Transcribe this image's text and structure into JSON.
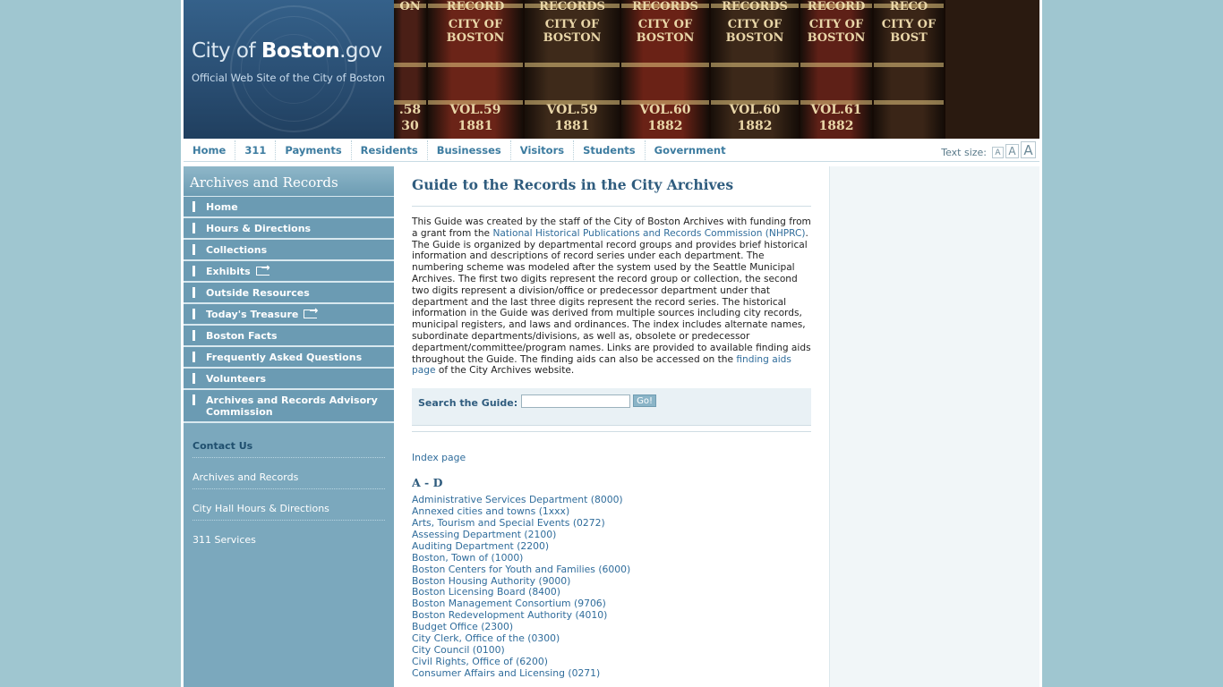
{
  "header": {
    "logo_city": "City of",
    "logo_boston": "Boston",
    "logo_domain": ".gov",
    "logo_tagline": "Official Web Site of the City of Boston",
    "books": [
      {
        "top": "ON",
        "mid": "",
        "vol": ".58",
        "year": "30"
      },
      {
        "top": "RECORD",
        "mid": "CITY OF\nBOSTON",
        "vol": "VOL.59",
        "year": "1881"
      },
      {
        "top": "RECORDS",
        "mid": "CITY OF\nBOSTON",
        "vol": "VOL.59",
        "year": "1881"
      },
      {
        "top": "RECORDS",
        "mid": "CITY OF\nBOSTON",
        "vol": "VOL.60",
        "year": "1882"
      },
      {
        "top": "RECORDS",
        "mid": "CITY OF\nBOSTON",
        "vol": "VOL.60",
        "year": "1882"
      },
      {
        "top": "RECORD",
        "mid": "CITY OF\nBOSTON",
        "vol": "VOL.61",
        "year": "1882"
      },
      {
        "top": "RECO",
        "mid": "CITY OF\nBOST",
        "vol": "",
        "year": ""
      }
    ]
  },
  "topnav": {
    "items": [
      "Home",
      "311",
      "Payments",
      "Residents",
      "Businesses",
      "Visitors",
      "Students",
      "Government"
    ],
    "text_size_label": "Text size:",
    "text_size_glyph": "A"
  },
  "sidebar": {
    "title": "Archives and Records",
    "menu": [
      {
        "label": "Home",
        "external": false
      },
      {
        "label": "Hours & Directions",
        "external": false
      },
      {
        "label": "Collections",
        "external": false
      },
      {
        "label": "Exhibits",
        "external": true
      },
      {
        "label": "Outside Resources",
        "external": false
      },
      {
        "label": "Today's Treasure",
        "external": true
      },
      {
        "label": "Boston Facts",
        "external": false
      },
      {
        "label": "Frequently Asked Questions",
        "external": false
      },
      {
        "label": "Volunteers",
        "external": false
      },
      {
        "label": "Archives and Records Advisory Commission",
        "external": false
      }
    ],
    "links": [
      "Contact Us",
      "Archives and Records",
      "City Hall Hours & Directions",
      "311 Services"
    ]
  },
  "main": {
    "title": "Guide to the Records in the City Archives",
    "intro_1": "This Guide was created by the staff of the City of Boston Archives with funding from a grant from the ",
    "intro_link_1": "National Historical Publications and Records Commission (NHPRC)",
    "intro_2": ". The Guide is organized by departmental record groups and provides brief historical information and descriptions of record series under each department. The numbering scheme was modeled after the system used by the Seattle Municipal Archives. The first two digits represent the record group or collection, the second two digits represent a division/office or predecessor department under that department and the last three digits represent the record series. The historical information in the Guide was derived from multiple sources including city records, municipal registers, and laws and ordinances. The index includes alternate names, subordinate departments/divisions, as well as, obsolete or predecessor department/committee/program names. Links are provided to available finding aids throughout the Guide. The finding aids can also be accessed on the ",
    "intro_link_2": "finding aids page",
    "intro_3": " of the City Archives website.",
    "search_label": "Search the Guide:",
    "search_value": "",
    "search_button": "Go!",
    "index_link": "Index page",
    "section": "A - D",
    "departments": [
      "Administrative Services Department (8000)",
      "Annexed cities and towns (1xxx)",
      "Arts, Tourism and Special Events (0272)",
      "Assessing Department (2100)",
      "Auditing Department (2200)",
      "Boston, Town of (1000)",
      "Boston Centers for Youth and Families (6000)",
      "Boston Housing Authority (9000)",
      "Boston Licensing Board (8400)",
      "Boston Management Consortium (9706)",
      "Boston Redevelopment Authority (4010)",
      "Budget Office (2300)",
      "City Clerk, Office of the (0300)",
      "City Council (0100)",
      "Civil Rights, Office of (6200)",
      "Consumer Affairs and Licensing (0271)"
    ]
  }
}
